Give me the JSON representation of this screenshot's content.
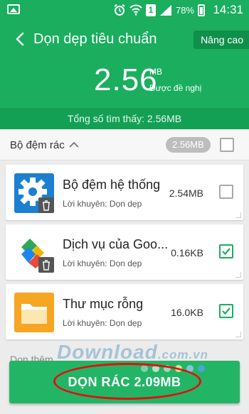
{
  "status_bar": {
    "battery": "78%",
    "time": "14:31",
    "sim": "1",
    "icons": [
      "gallery-icon",
      "alarm-icon",
      "wifi-icon",
      "sim-icon",
      "signal-icon",
      "battery-icon"
    ]
  },
  "header": {
    "title": "Dọn dẹp tiêu chuẩn",
    "advanced_label": "Nâng cao",
    "size_value": "2.56",
    "size_unit": "MB",
    "size_note": "Được đề nghị"
  },
  "found_text": "Tổng số tìm thấy: 2.56MB",
  "group": {
    "title": "Bộ đệm rác",
    "badge": "2.56MB",
    "checked": false
  },
  "items": [
    {
      "title": "Bộ đệm hệ thống",
      "subtitle": "Lời khuyên: Dọn dẹp",
      "size": "2.54MB",
      "checked": false,
      "icon": "settings-gear-icon"
    },
    {
      "title": "Dịch vụ của Goo...",
      "subtitle": "Lời khuyên: Dọn dẹp",
      "size": "0.16KB",
      "checked": true,
      "icon": "google-play-services-icon"
    },
    {
      "title": "Thư mục rỗng",
      "subtitle": "Lời khuyên: Dọn dẹp",
      "size": "16.0KB",
      "checked": true,
      "icon": "folder-icon"
    }
  ],
  "more_text": "Dọn thêm",
  "watermark": {
    "main": "Download",
    "suffix": ".com.vn"
  },
  "clean_button": {
    "label": "DỌN RÁC 2.09MB"
  },
  "colors": {
    "brand_green": "#1aae5e",
    "dark_green": "#13a054",
    "highlight_red": "#e01010"
  }
}
